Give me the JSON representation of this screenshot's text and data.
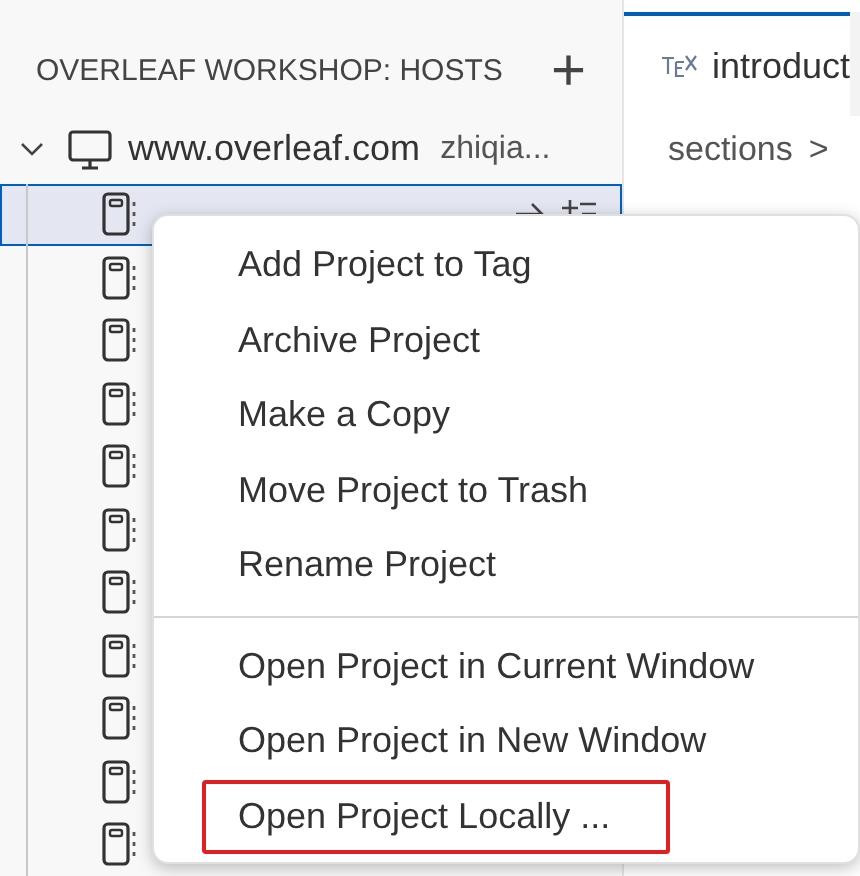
{
  "sidebar": {
    "title": "OVERLEAF WORKSHOP: HOSTS",
    "add_button": "+"
  },
  "host": {
    "label": "www.overleaf.com",
    "user": "zhiqia...",
    "expanded": true
  },
  "projects": [
    {
      "selected": true
    },
    {
      "selected": false
    },
    {
      "selected": false
    },
    {
      "selected": false
    },
    {
      "selected": false
    },
    {
      "selected": false
    },
    {
      "selected": false
    },
    {
      "selected": false
    },
    {
      "selected": false
    },
    {
      "selected": false
    },
    {
      "selected": false
    }
  ],
  "editor": {
    "tab": {
      "label": "introduct",
      "selected": true
    },
    "breadcrumb": [
      "sections",
      ">"
    ]
  },
  "context_menu": {
    "groups": [
      [
        {
          "label": "Add Project to Tag",
          "outlined": false
        },
        {
          "label": "Archive Project",
          "outlined": false
        },
        {
          "label": "Make a Copy",
          "outlined": false
        },
        {
          "label": "Move Project to Trash",
          "outlined": false
        },
        {
          "label": "Rename Project",
          "outlined": false
        }
      ],
      [
        {
          "label": "Open Project in Current Window",
          "outlined": false
        },
        {
          "label": "Open Project in New Window",
          "outlined": false
        },
        {
          "label": "Open Project Locally ...",
          "outlined": true
        }
      ]
    ]
  }
}
